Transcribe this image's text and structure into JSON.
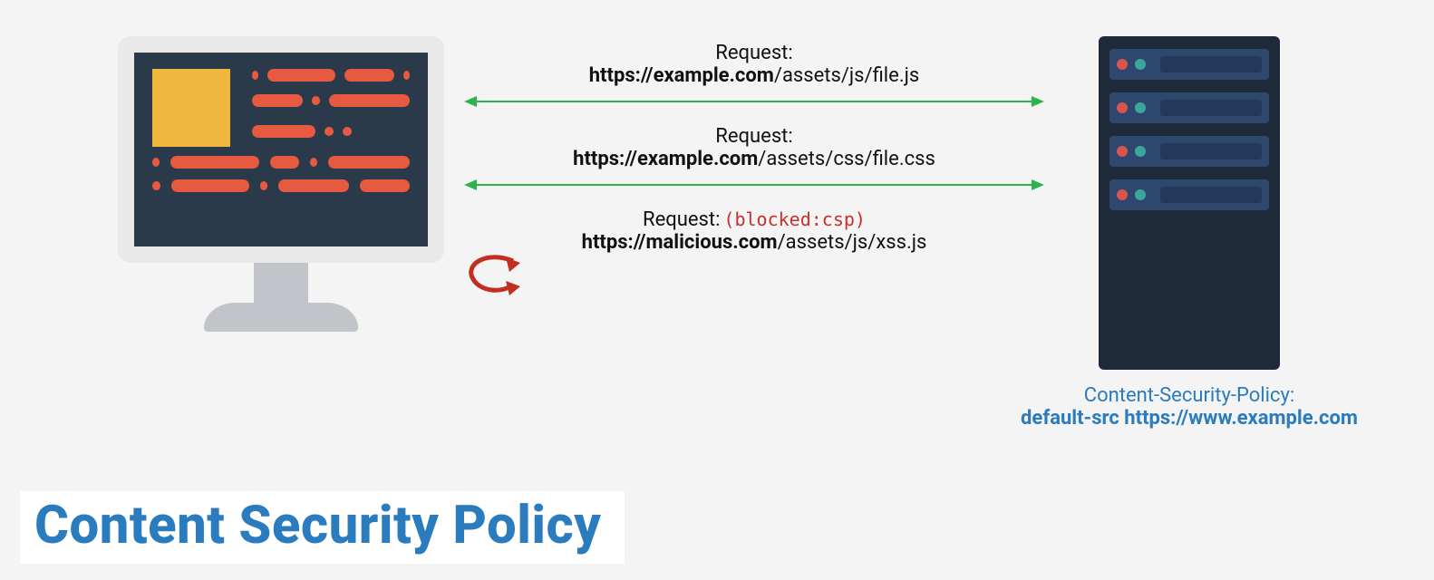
{
  "title": "Content Security Policy",
  "requests": [
    {
      "label": "Request:",
      "url_domain": "https://example.com",
      "url_path": "/assets/js/file.js",
      "status": "allowed"
    },
    {
      "label": "Request:",
      "url_domain": "https://example.com",
      "url_path": "/assets/css/file.css",
      "status": "allowed"
    },
    {
      "label": "Request:",
      "blocked_tag": "(blocked:csp)",
      "url_domain": "https://malicious.com",
      "url_path": "/assets/js/xss.js",
      "status": "blocked"
    }
  ],
  "server_caption": {
    "line1": "Content-Security-Policy:",
    "line2": "default-src https://www.example.com"
  },
  "colors": {
    "allowed_arrow": "#2fb24c",
    "blocked_arrow": "#c22e1f",
    "brand_blue": "#2b7bbf",
    "screen_bg": "#2b3a4a",
    "screen_bar": "#e75a42",
    "icon_yellow": "#efb73e",
    "server_bg": "#1e2a3a",
    "server_drive": "#2e486d",
    "led_red": "#d9534f",
    "led_teal": "#3aa79a"
  }
}
